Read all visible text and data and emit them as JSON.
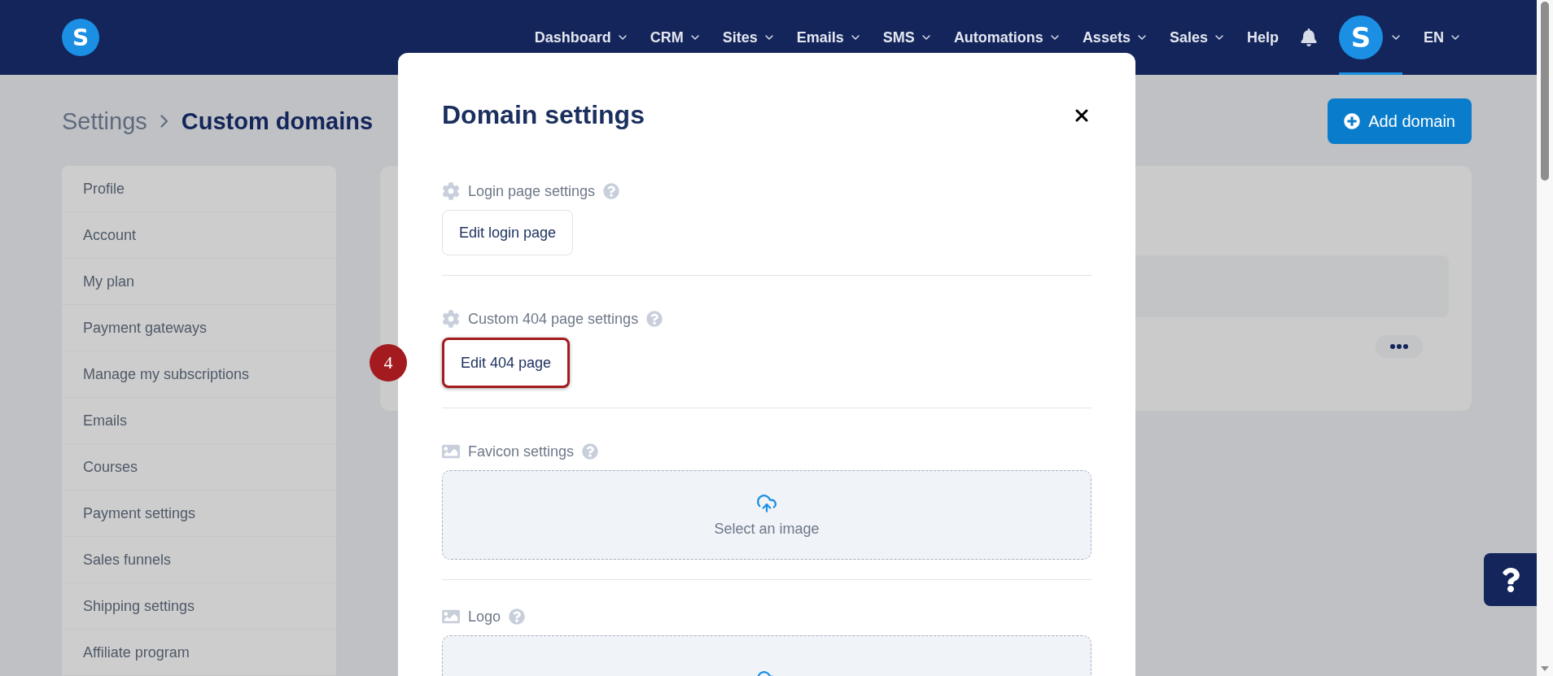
{
  "topbar": {
    "logo": "S",
    "menu": [
      {
        "label": "Dashboard",
        "has_menu": true
      },
      {
        "label": "CRM",
        "has_menu": true
      },
      {
        "label": "Sites",
        "has_menu": true
      },
      {
        "label": "Emails",
        "has_menu": true
      },
      {
        "label": "SMS",
        "has_menu": true
      },
      {
        "label": "Automations",
        "has_menu": true
      },
      {
        "label": "Assets",
        "has_menu": true
      },
      {
        "label": "Sales",
        "has_menu": true
      },
      {
        "label": "Help",
        "has_menu": false
      }
    ],
    "avatar": "S",
    "language": "EN"
  },
  "breadcrumb": [
    "Settings",
    "Custom domains"
  ],
  "add_button": "Add domain",
  "sidebar": {
    "items": [
      {
        "label": "Profile"
      },
      {
        "label": "Account"
      },
      {
        "label": "My plan"
      },
      {
        "label": "Payment gateways"
      },
      {
        "label": "Manage my subscriptions"
      },
      {
        "label": "Emails"
      },
      {
        "label": "Courses"
      },
      {
        "label": "Payment settings"
      },
      {
        "label": "Sales funnels"
      },
      {
        "label": "Shipping settings"
      },
      {
        "label": "Affiliate program"
      }
    ]
  },
  "modal": {
    "title": "Domain settings",
    "sections": [
      {
        "kind": "button",
        "label": "Login page settings",
        "button": "Edit login page",
        "highlighted": false
      },
      {
        "kind": "button",
        "label": "Custom 404 page settings",
        "button": "Edit 404 page",
        "highlighted": true,
        "step": "4"
      },
      {
        "kind": "upload",
        "label": "Favicon settings",
        "upload_text": "Select an image"
      },
      {
        "kind": "upload",
        "label": "Logo"
      }
    ]
  }
}
